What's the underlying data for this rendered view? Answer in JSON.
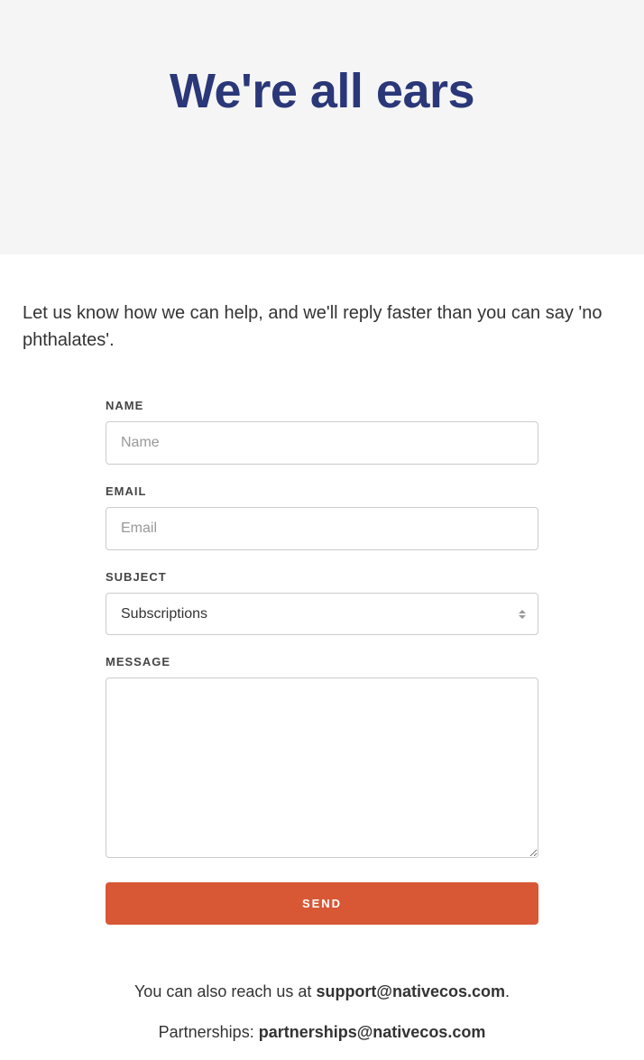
{
  "hero": {
    "title": "We're all ears"
  },
  "intro": "Let us know how we can help, and we'll reply faster than you can say 'no phthalates'.",
  "form": {
    "name": {
      "label": "NAME",
      "placeholder": "Name",
      "value": ""
    },
    "email": {
      "label": "EMAIL",
      "placeholder": "Email",
      "value": ""
    },
    "subject": {
      "label": "SUBJECT",
      "selected": "Subscriptions"
    },
    "message": {
      "label": "MESSAGE",
      "value": ""
    },
    "submit": "SEND"
  },
  "footer": {
    "reach_prefix": "You can also reach us at ",
    "support_email": "support@nativecos.com",
    "reach_suffix": ".",
    "partnerships_prefix": "Partnerships: ",
    "partnerships_email": "partnerships@nativecos.com"
  }
}
